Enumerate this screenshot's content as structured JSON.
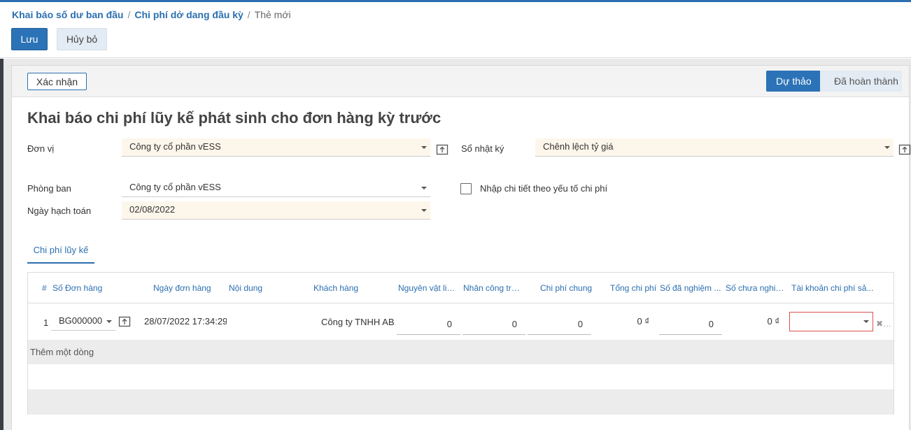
{
  "breadcrumb": {
    "items": [
      "Khai báo số dư ban đầu",
      "Chi phí dở dang đầu kỳ"
    ],
    "current": "Thẻ mới",
    "separator": "/"
  },
  "toolbar": {
    "save_label": "Lưu",
    "discard_label": "Hủy bỏ"
  },
  "statusbar": {
    "confirm_label": "Xác nhận",
    "stages": [
      "Dự thảo",
      "Đã hoàn thành"
    ],
    "active_stage": "Dự thảo"
  },
  "form": {
    "title": "Khai báo chi phí lũy kế phát sinh cho đơn hàng kỳ trước",
    "fields": {
      "company": {
        "label": "Đơn vị",
        "value": "Công ty cổ phần vESS"
      },
      "journal": {
        "label": "Sổ nhật ký",
        "value": "Chênh lệch tỷ giá"
      },
      "department": {
        "label": "Phòng ban",
        "value": "Công ty cổ phần vESS"
      },
      "accounting_date": {
        "label": "Ngày hạch toán",
        "value": "02/08/2022"
      },
      "detail_by_cost": {
        "label": "Nhập chi tiết theo yếu tố chi phí",
        "checked": false
      }
    }
  },
  "tabs": [
    {
      "label": "Chi phí lũy kế",
      "active": true
    }
  ],
  "grid": {
    "columns": {
      "index": "#",
      "order": "Số Đơn hàng",
      "order_date": "Ngày đơn hàng",
      "content": "Nội dung",
      "customer": "Khách hàng",
      "material": "Nguyên vật liệ...",
      "labor": "Nhân công trự...",
      "overhead": "Chi phí chung",
      "total": "Tổng chi phí",
      "accepted": "Số đã nghiệm ...",
      "not_accepted": "Số chưa nghiệ...",
      "account": "Tài khoản chi phí sả..."
    },
    "rows": [
      {
        "index": "1",
        "order": "BG000000",
        "order_date": "28/07/2022 17:34:29",
        "content": "",
        "customer": "Công ty TNHH AB, I",
        "material": "0",
        "labor": "0",
        "overhead": "0",
        "total": "0 ₫",
        "accepted": "0",
        "not_accepted": "0 ₫",
        "account": ""
      }
    ],
    "add_line_label": "Thêm một dòng"
  },
  "colors": {
    "primary": "#2b73b6",
    "link": "#2b6fb0",
    "required_bg": "#fdf6eb",
    "error_border": "#d9534f"
  },
  "icons": {
    "external_link": "external-link-icon",
    "delete": "trash-icon",
    "dropdown": "chevron-down-icon"
  }
}
